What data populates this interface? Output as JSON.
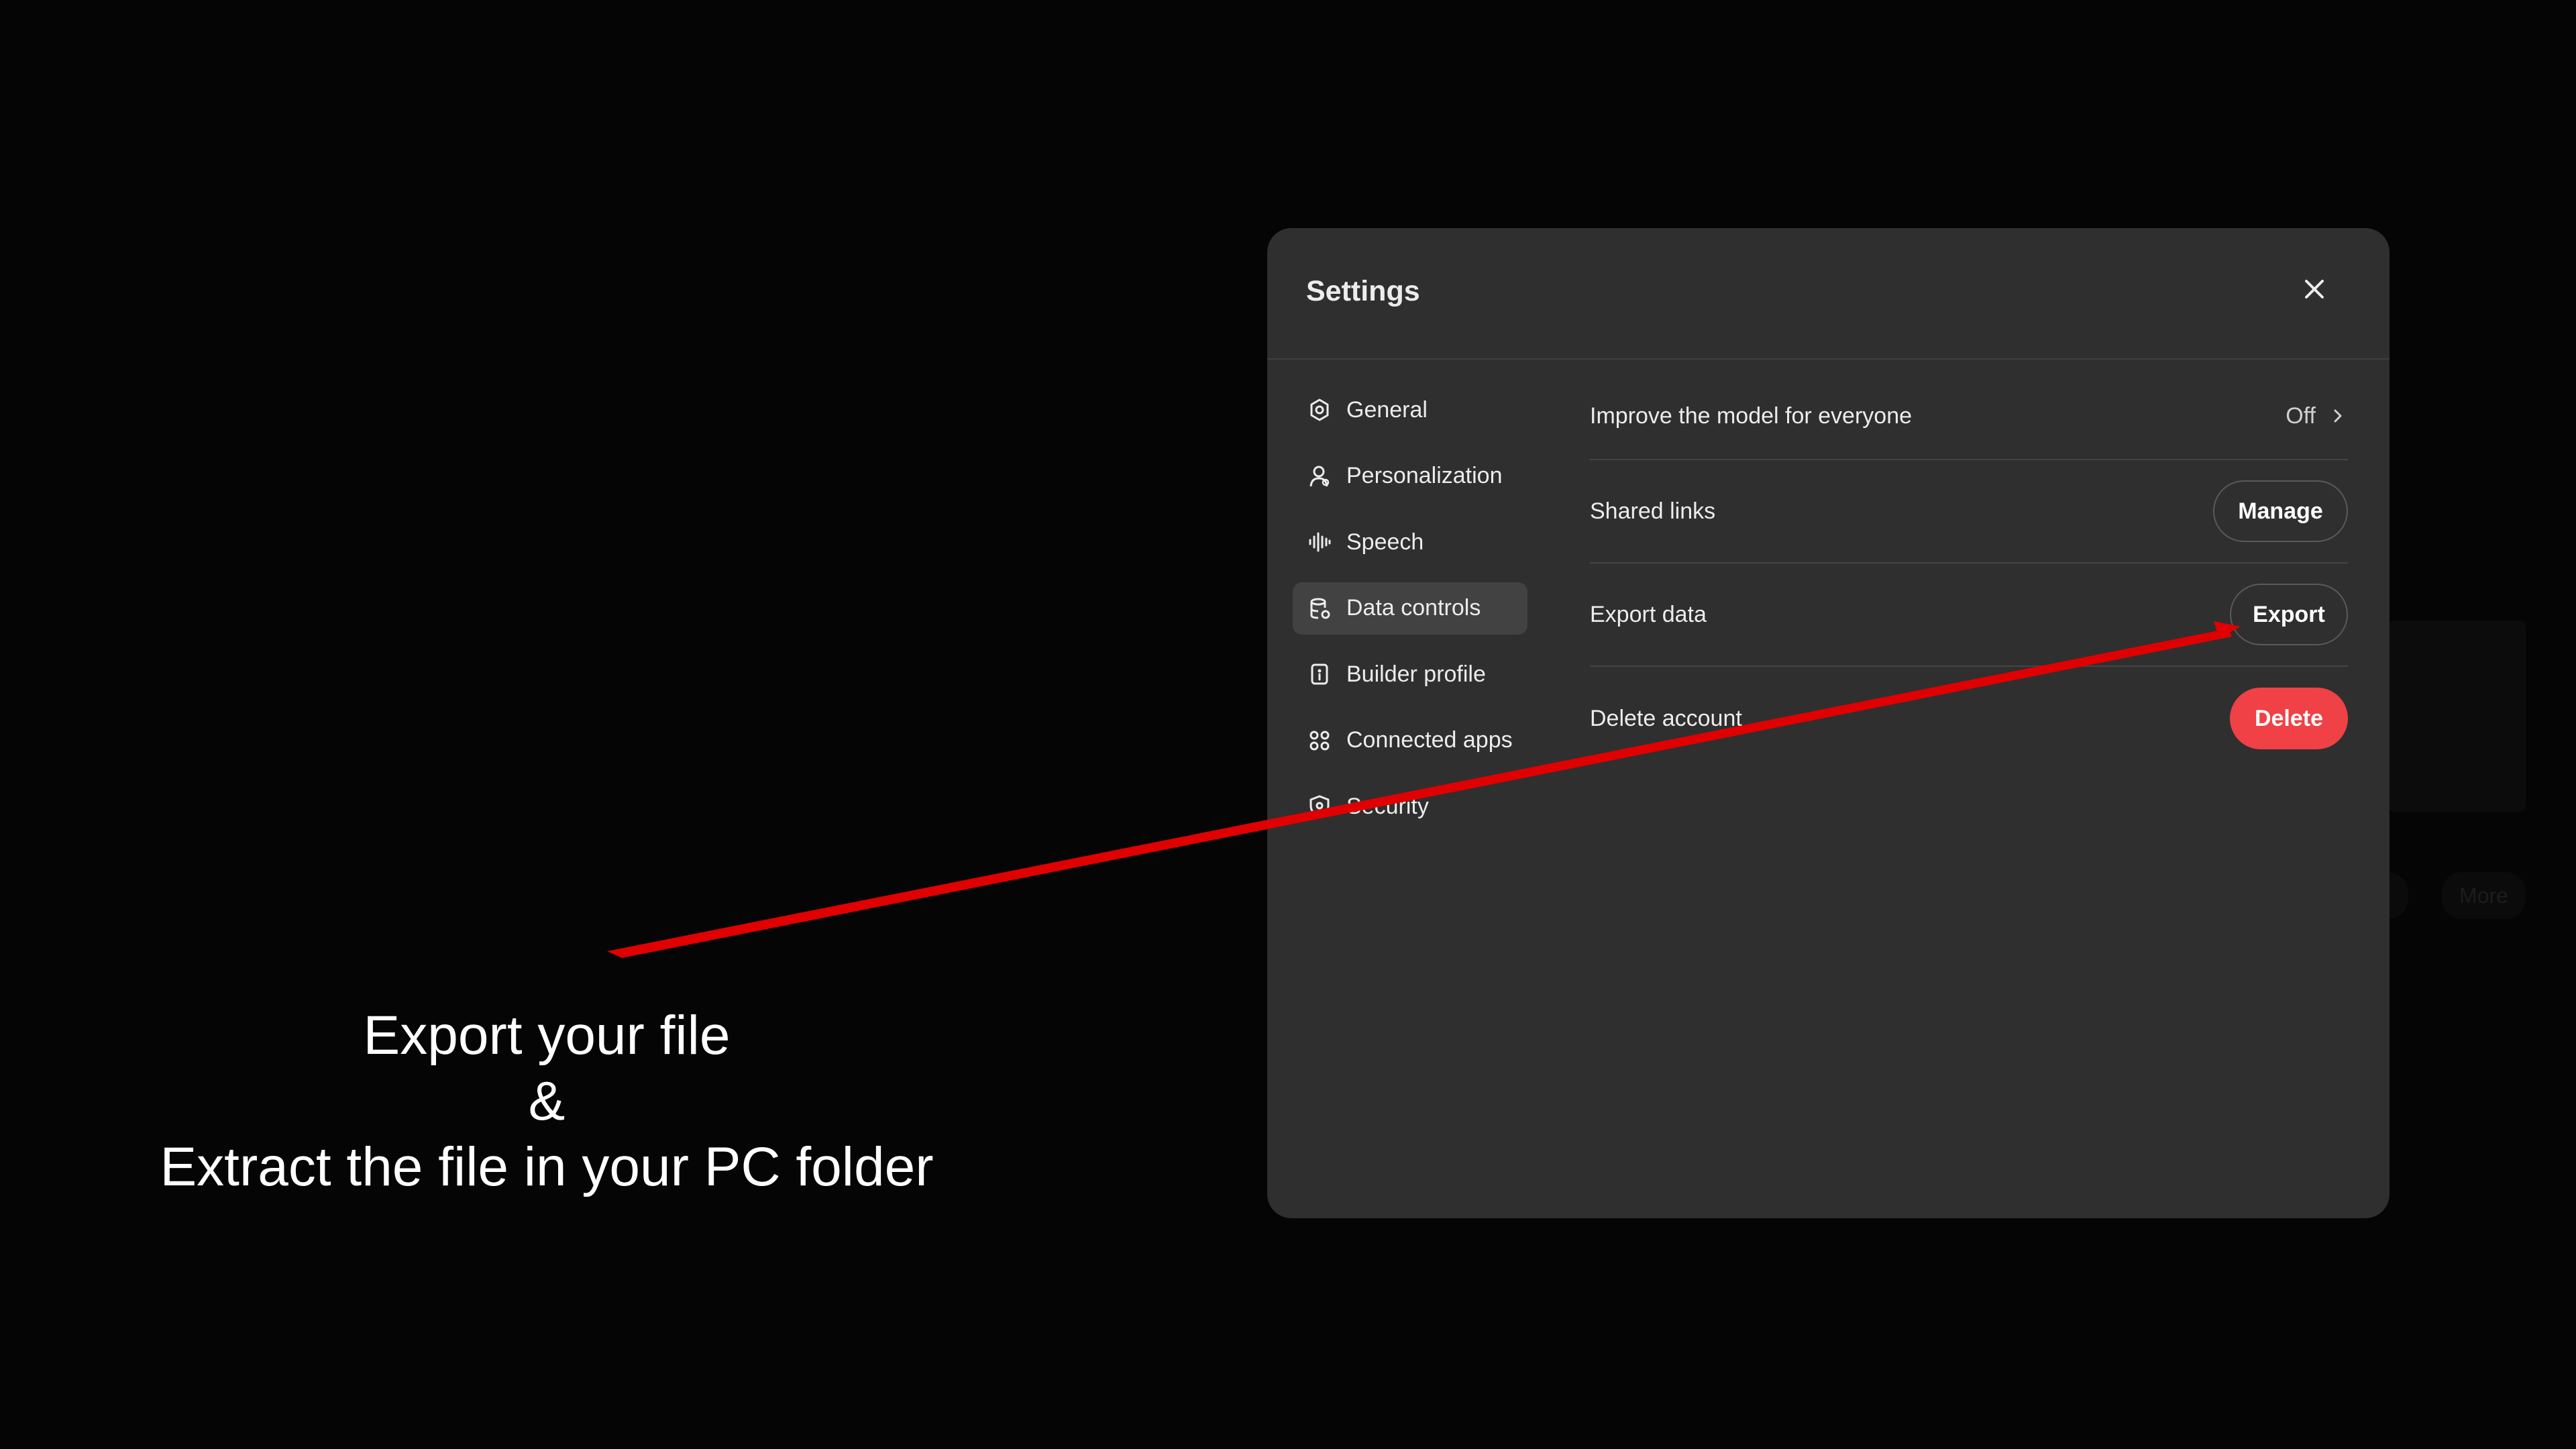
{
  "background": {
    "more_label": "More"
  },
  "modal": {
    "title": "Settings",
    "nav": [
      {
        "label": "General",
        "icon": "gear-icon"
      },
      {
        "label": "Personalization",
        "icon": "person-icon"
      },
      {
        "label": "Speech",
        "icon": "waveform-icon"
      },
      {
        "label": "Data controls",
        "icon": "database-icon",
        "active": true
      },
      {
        "label": "Builder profile",
        "icon": "id-badge-icon"
      },
      {
        "label": "Connected apps",
        "icon": "apps-grid-icon"
      },
      {
        "label": "Security",
        "icon": "shield-icon"
      }
    ],
    "rows": {
      "improve": {
        "label": "Improve the model for everyone",
        "value": "Off"
      },
      "shared": {
        "label": "Shared links",
        "button": "Manage"
      },
      "export": {
        "label": "Export data",
        "button": "Export"
      },
      "delete": {
        "label": "Delete account",
        "button": "Delete"
      }
    }
  },
  "annotation": {
    "line1": "Export your file",
    "line2": "&",
    "line3": "Extract the file in your PC folder",
    "arrow_color": "#e00000"
  },
  "colors": {
    "modal_bg": "#2f2f2f",
    "danger": "#ef4146",
    "page_bg": "#050505"
  }
}
